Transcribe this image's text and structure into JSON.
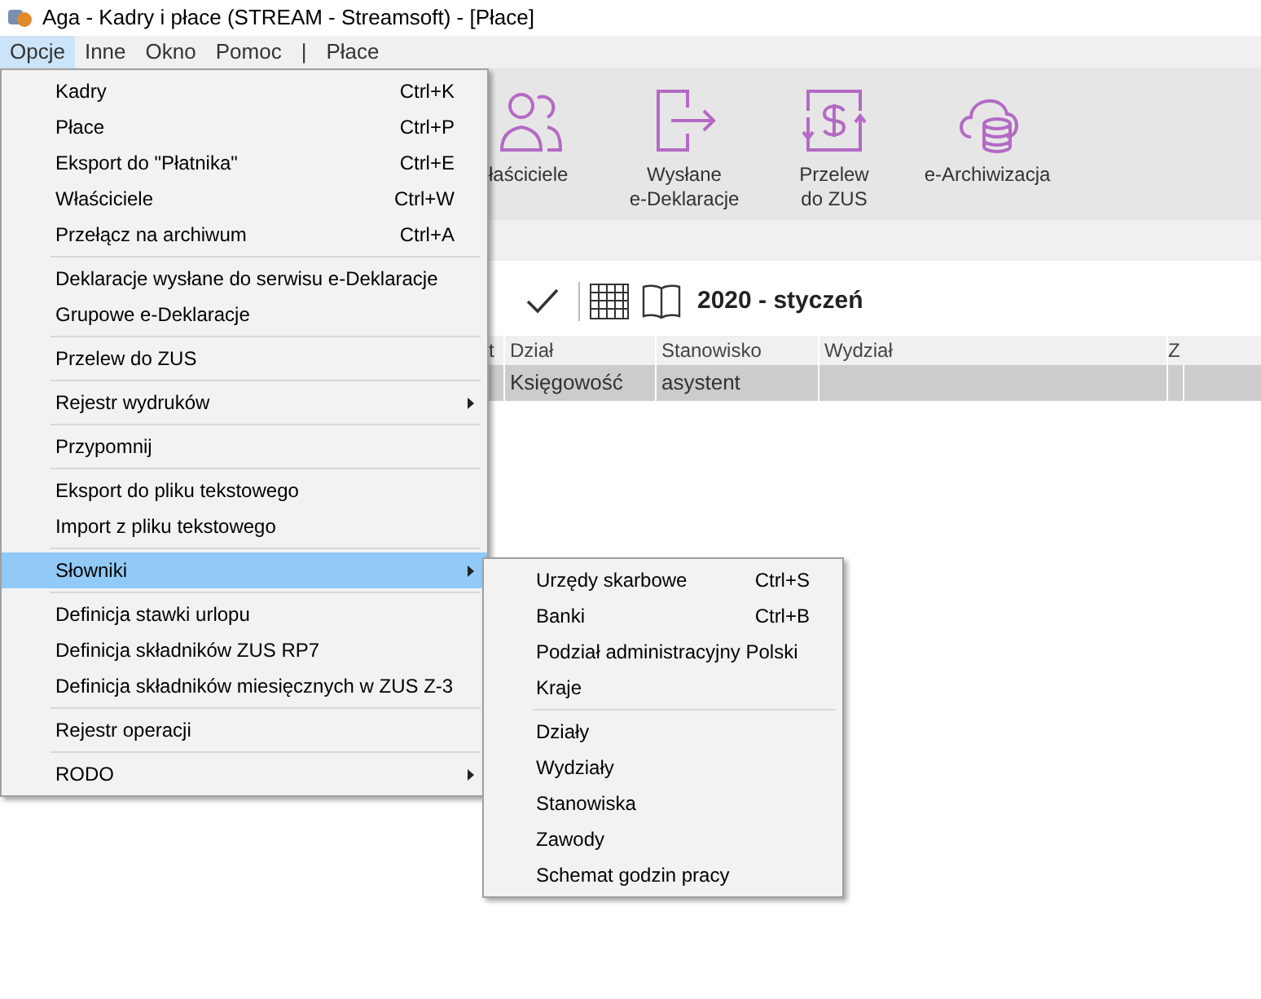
{
  "window": {
    "title": "Aga - Kadry i płace (STREAM - Streamsoft) - [Płace]"
  },
  "menubar": [
    {
      "label": "Opcje",
      "selected": true
    },
    {
      "label": "Inne",
      "selected": false
    },
    {
      "label": "Okno",
      "selected": false
    },
    {
      "label": "Pomoc",
      "selected": false
    },
    {
      "label": "|",
      "selected": false
    },
    {
      "label": "Płace",
      "selected": false
    }
  ],
  "ribbon": [
    {
      "label": "łaściciele",
      "kind": "people"
    },
    {
      "label": "Wysłane\ne-Deklaracje",
      "kind": "export"
    },
    {
      "label": "Przelew\ndo ZUS",
      "kind": "transfer"
    },
    {
      "label": "e-Archiwizacja",
      "kind": "cloud"
    }
  ],
  "period": "2020 - styczeń",
  "table": {
    "columns": [
      "t",
      "Dział",
      "Stanowisko",
      "Wydział",
      "Z"
    ],
    "rows": [
      {
        "selected": true,
        "cells": [
          null,
          "Księgowość",
          "asystent",
          null,
          null
        ]
      }
    ]
  },
  "menu": [
    [
      {
        "label": "Kadry",
        "shortcut": "Ctrl+K"
      },
      {
        "label": "Płace",
        "shortcut": "Ctrl+P"
      },
      {
        "label": "Eksport do \"Płatnika\"",
        "shortcut": "Ctrl+E"
      },
      {
        "label": "Właściciele",
        "shortcut": "Ctrl+W"
      },
      {
        "label": "Przełącz na archiwum",
        "shortcut": "Ctrl+A"
      }
    ],
    [
      {
        "label": "Deklaracje wysłane do serwisu e-Deklaracje"
      },
      {
        "label": "Grupowe e-Deklaracje"
      }
    ],
    [
      {
        "label": "Przelew do ZUS"
      }
    ],
    [
      {
        "label": "Rejestr wydruków",
        "submenu": true
      }
    ],
    [
      {
        "label": "Przypomnij"
      }
    ],
    [
      {
        "label": "Eksport do pliku tekstowego"
      },
      {
        "label": "Import z pliku tekstowego"
      }
    ],
    [
      {
        "label": "Słowniki",
        "submenu": true,
        "selected": true
      }
    ],
    [
      {
        "label": "Definicja stawki urlopu"
      },
      {
        "label": "Definicja składników ZUS RP7"
      },
      {
        "label": "Definicja składników miesięcznych w ZUS Z-3"
      }
    ],
    [
      {
        "label": "Rejestr operacji"
      }
    ],
    [
      {
        "label": "RODO",
        "submenu": true
      }
    ]
  ],
  "submenu": [
    [
      {
        "label": "Urzędy skarbowe",
        "shortcut": "Ctrl+S"
      },
      {
        "label": "Banki",
        "shortcut": "Ctrl+B"
      },
      {
        "label": "Podział administracyjny Polski"
      },
      {
        "label": "Kraje"
      }
    ],
    [
      {
        "label": "Działy"
      },
      {
        "label": "Wydziały"
      },
      {
        "label": "Stanowiska"
      },
      {
        "label": "Zawody"
      },
      {
        "label": "Schemat godzin pracy"
      }
    ]
  ]
}
